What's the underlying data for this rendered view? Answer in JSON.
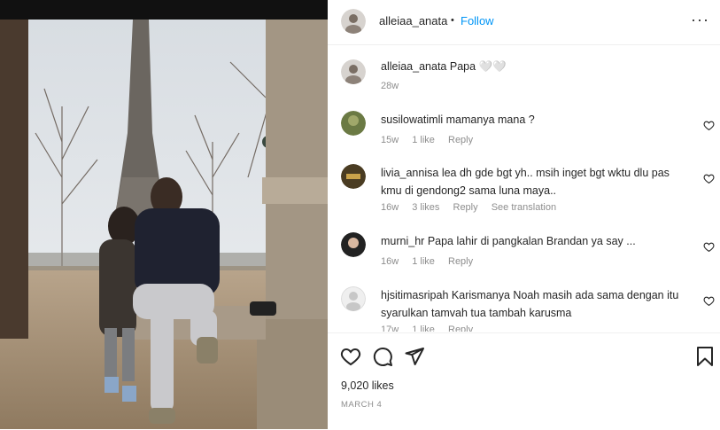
{
  "post": {
    "username": "alleiaa_anata",
    "follow_label": "Follow",
    "separator": "•",
    "more_label": "···"
  },
  "caption": {
    "username": "alleiaa_anata",
    "text": "Papa 🤍🤍",
    "time": "28w"
  },
  "comments": [
    {
      "username": "susilowatimli",
      "text": "mamanya mana ?",
      "time": "15w",
      "likes": "1 like",
      "reply": "Reply"
    },
    {
      "username": "livia_annisa",
      "text": "lea dh gde bgt yh.. msih inget bgt wktu dlu pas kmu di gendong2 sama luna maya..",
      "time": "16w",
      "likes": "3 likes",
      "reply": "Reply",
      "translate": "See translation"
    },
    {
      "username": "murni_hr",
      "text": "Papa lahir di pangkalan Brandan ya say ...",
      "time": "16w",
      "likes": "1 like",
      "reply": "Reply"
    },
    {
      "username": "hjsitimasripah",
      "text": "Karismanya Noah masih ada sama dengan itu syarulkan tamvah tua tambah karusma",
      "time": "17w",
      "likes": "1 like",
      "reply": "Reply"
    }
  ],
  "footer": {
    "likes": "9,020 likes",
    "date": "MARCH 4"
  },
  "icons": [
    "heart-icon",
    "comment-icon",
    "share-icon",
    "bookmark-icon",
    "more-icon"
  ],
  "colors": {
    "follow": "#0095f6",
    "meta": "#8e8e8e",
    "text": "#262626"
  }
}
